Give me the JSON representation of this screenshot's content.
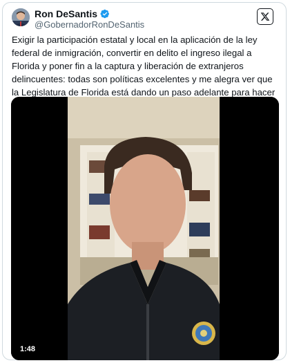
{
  "tweet": {
    "author": {
      "display_name": "Ron DeSantis",
      "handle": "@GobernadorRonDeSantis",
      "verified": true
    },
    "text": "Exigir la participación estatal y local en la aplicación de la ley federal de inmigración, convertir en delito el ingreso ilegal a Florida y poner fin a la captura y liberación de extranjeros delincuentes: todas son políticas excelentes y me alegra ver que la Legislatura de Florida está dando un paso adelante para hacer el trabajo...",
    "media": {
      "type": "video",
      "duration": "1:48"
    }
  },
  "icons": {
    "verified": "verified-badge-icon",
    "brand": "x-logo-icon"
  },
  "colors": {
    "text": "#0f1419",
    "secondary_text": "#536471",
    "verified_blue": "#1d9bf0",
    "border": "#cfd9de"
  }
}
